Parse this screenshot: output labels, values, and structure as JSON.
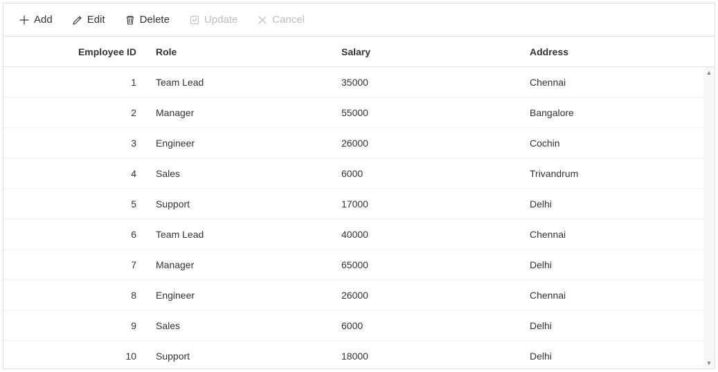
{
  "toolbar": {
    "add_label": "Add",
    "edit_label": "Edit",
    "delete_label": "Delete",
    "update_label": "Update",
    "cancel_label": "Cancel"
  },
  "columns": {
    "employee_id": "Employee ID",
    "role": "Role",
    "salary": "Salary",
    "address": "Address"
  },
  "rows": [
    {
      "id": "1",
      "role": "Team Lead",
      "salary": "35000",
      "address": "Chennai"
    },
    {
      "id": "2",
      "role": "Manager",
      "salary": "55000",
      "address": "Bangalore"
    },
    {
      "id": "3",
      "role": "Engineer",
      "salary": "26000",
      "address": "Cochin"
    },
    {
      "id": "4",
      "role": "Sales",
      "salary": "6000",
      "address": "Trivandrum"
    },
    {
      "id": "5",
      "role": "Support",
      "salary": "17000",
      "address": "Delhi"
    },
    {
      "id": "6",
      "role": "Team Lead",
      "salary": "40000",
      "address": "Chennai"
    },
    {
      "id": "7",
      "role": "Manager",
      "salary": "65000",
      "address": "Delhi"
    },
    {
      "id": "8",
      "role": "Engineer",
      "salary": "26000",
      "address": "Chennai"
    },
    {
      "id": "9",
      "role": "Sales",
      "salary": "6000",
      "address": "Delhi"
    },
    {
      "id": "10",
      "role": "Support",
      "salary": "18000",
      "address": "Delhi"
    }
  ]
}
